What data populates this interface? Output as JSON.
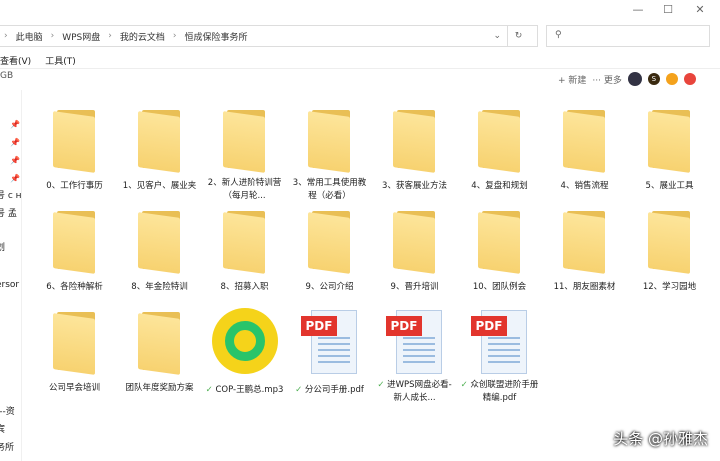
{
  "window": {
    "minimize": "—",
    "maximize": "☐",
    "close": "✕"
  },
  "breadcrumb": [
    "此电脑",
    "WPS网盘",
    "我的云文档",
    "恒成保险事务所"
  ],
  "menu": [
    "查看(V)",
    "工具(T)"
  ],
  "status": "GB",
  "toolbar": {
    "new": "+ 新建",
    "more": "··· 更多"
  },
  "sidebar": [
    "号 c н",
    "号 孟",
    "划",
    "ersor",
    "---资",
    "宾",
    "务所"
  ],
  "items": [
    {
      "type": "folder",
      "name": "0、工作行事历"
    },
    {
      "type": "folder",
      "name": "1、见客户、展业夹"
    },
    {
      "type": "folder",
      "name": "2、新人进阶特训营（每月轮..."
    },
    {
      "type": "folder",
      "name": "3、常用工具使用教程（必看）"
    },
    {
      "type": "folder",
      "name": "3、获客展业方法"
    },
    {
      "type": "folder",
      "name": "4、复盘和规划"
    },
    {
      "type": "folder",
      "name": "4、销售流程"
    },
    {
      "type": "folder",
      "name": "5、展业工具"
    },
    {
      "type": "folder",
      "name": "6、各险种解析"
    },
    {
      "type": "folder",
      "name": "8、年金险特训"
    },
    {
      "type": "folder",
      "name": "8、招募入职"
    },
    {
      "type": "folder",
      "name": "9、公司介绍"
    },
    {
      "type": "folder",
      "name": "9、晋升培训"
    },
    {
      "type": "folder",
      "name": "10、团队例会"
    },
    {
      "type": "folder",
      "name": "11、朋友圈素材"
    },
    {
      "type": "folder",
      "name": "12、学习园地"
    },
    {
      "type": "folder",
      "name": "公司早会培训"
    },
    {
      "type": "folder",
      "name": "团队年度奖励方案"
    },
    {
      "type": "music",
      "name": "COP-王鹏总.mp3",
      "synced": true
    },
    {
      "type": "pdf",
      "name": "分公司手册.pdf",
      "synced": true
    },
    {
      "type": "pdf",
      "name": "进WPS网盘必看-新人成长...",
      "synced": true
    },
    {
      "type": "pdf",
      "name": "众创联盟进阶手册精编.pdf",
      "synced": true
    }
  ],
  "pdf_tag": "PDF",
  "watermark": "头条 @孙雅杰"
}
